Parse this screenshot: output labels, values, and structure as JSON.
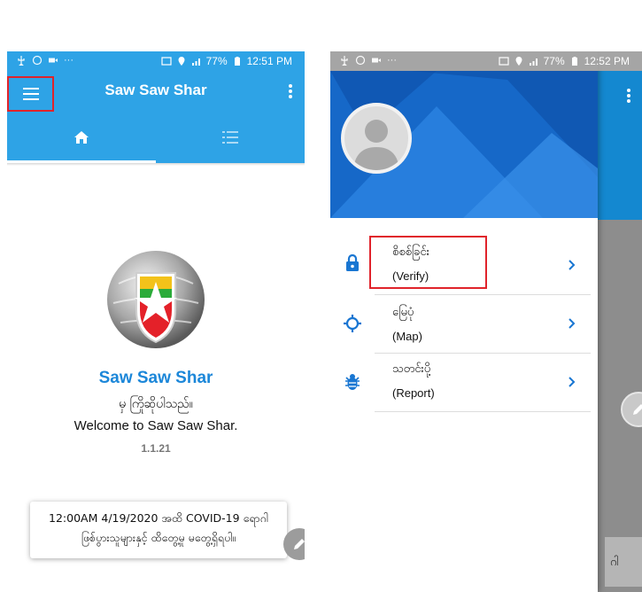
{
  "colors": {
    "app_bar": "#2ea3e6",
    "accent_blue": "#1c87d9",
    "highlight_red": "#e0232b",
    "drawer_header": "#1a6fd0",
    "nav_icon_blue": "#1976d2"
  },
  "screen_home": {
    "status_bar": {
      "battery": "77%",
      "time": "12:51 PM"
    },
    "app_bar": {
      "title": "Saw Saw Shar",
      "menu_icon": "hamburger-menu-icon",
      "more_icon": "more-vertical-icon"
    },
    "tabs": [
      {
        "icon": "home-icon",
        "selected": true
      },
      {
        "icon": "list-icon",
        "selected": false
      }
    ],
    "welcome": {
      "title": "Saw Saw Shar",
      "subtitle_my": "မှ ကြိုဆိုပါသည်။",
      "subtitle_en": "Welcome to Saw Saw Shar.",
      "version": "1.1.21"
    },
    "notice": {
      "line1": "12:00AM 4/19/2020 အထိ COVID-19 ရောဂါ",
      "line2": "ဖြစ်ပွားသူများနှင့် ထိတွေ့မှု မတွေ့ရှိရပါ။"
    },
    "fab_icon": "edit-icon"
  },
  "screen_drawer": {
    "status_bar": {
      "battery": "77%",
      "time": "12:52 PM"
    },
    "profile_icon": "person-icon",
    "menu_items": [
      {
        "label_my": "စိစစ်ခြင်း",
        "label_en": "(Verify)",
        "icon": "lock-icon",
        "highlighted": true
      },
      {
        "label_my": "မြေပုံ",
        "label_en": "(Map)",
        "icon": "location-target-icon",
        "highlighted": false
      },
      {
        "label_my": "သတင်းပို့",
        "label_en": "(Report)",
        "icon": "bug-icon",
        "highlighted": false
      }
    ],
    "underlying_card_text": "ဂါ"
  }
}
